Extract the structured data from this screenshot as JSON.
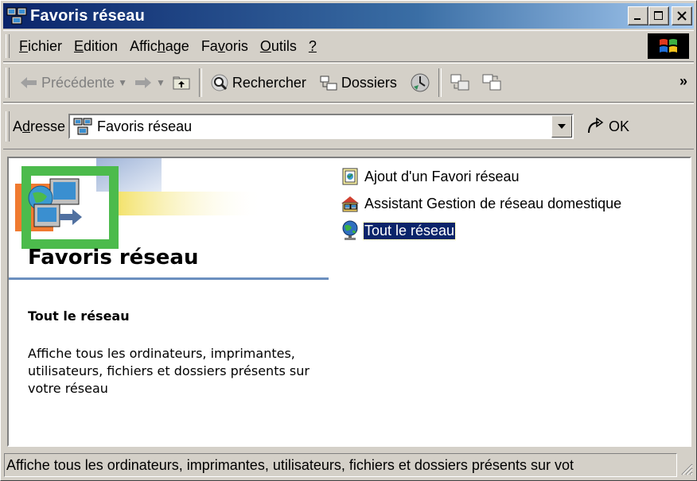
{
  "window": {
    "title": "Favoris réseau"
  },
  "menu": {
    "items": [
      {
        "pre": "",
        "key": "F",
        "post": "ichier"
      },
      {
        "pre": "",
        "key": "E",
        "post": "dition"
      },
      {
        "pre": "Affic",
        "key": "h",
        "post": "age"
      },
      {
        "pre": "Fa",
        "key": "v",
        "post": "oris"
      },
      {
        "pre": "",
        "key": "O",
        "post": "utils"
      },
      {
        "pre": "",
        "key": "?",
        "post": ""
      }
    ]
  },
  "toolbar": {
    "back_label": "Précédente",
    "search_label": "Rechercher",
    "folders_label": "Dossiers"
  },
  "address": {
    "label_pre": "A",
    "label_key": "d",
    "label_post": "resse",
    "value": "Favoris réseau",
    "go_label": "OK"
  },
  "panel": {
    "title": "Favoris réseau",
    "selected_title": "Tout le réseau",
    "selected_description": "Affiche tous les ordinateurs, imprimantes, utilisateurs, fichiers et dossiers présents sur votre réseau"
  },
  "files": [
    {
      "label": "Ajout d'un Favori réseau",
      "icon": "add-network-place-icon"
    },
    {
      "label": "Assistant Gestion de réseau domestique",
      "icon": "home-network-wizard-icon"
    },
    {
      "label": "Tout le réseau",
      "icon": "entire-network-icon",
      "selected": true
    }
  ],
  "status": {
    "text": "Affiche tous les ordinateurs, imprimantes, utilisateurs, fichiers et dossiers présents sur vot"
  },
  "colors": {
    "titlebar_start": "#0a246a",
    "titlebar_end": "#a6caf0",
    "face": "#d4d0c8",
    "selection": "#0a246a",
    "panel_rule": "#6b8fbf"
  }
}
